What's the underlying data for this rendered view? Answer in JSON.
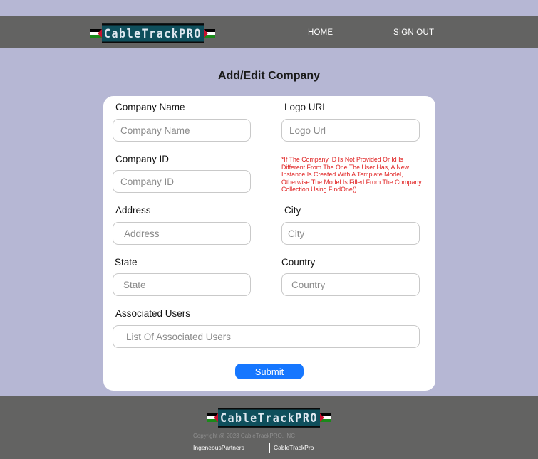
{
  "header": {
    "logo_text": "CableTrackPRO",
    "nav": {
      "home": "HOME",
      "sign_out": "SIGN OUT"
    }
  },
  "page": {
    "title": "Add/Edit Company"
  },
  "form": {
    "company_name": {
      "label": "Company Name",
      "placeholder": "Company Name",
      "value": ""
    },
    "logo_url": {
      "label": "Logo URL",
      "placeholder": "Logo Url",
      "value": ""
    },
    "company_id": {
      "label": "Company ID",
      "placeholder": "Company ID",
      "value": ""
    },
    "company_id_note": "*If The Company ID Is Not Provided Or Id Is Different From The One The User Has, A New Instance Is Created With A Template Model, Otherwise The Model Is Filled From The Company Collection Using FindOne().",
    "address": {
      "label": "Address",
      "placeholder": "Address",
      "value": ""
    },
    "city": {
      "label": "City",
      "placeholder": "City",
      "value": ""
    },
    "state": {
      "label": "State",
      "placeholder": "State",
      "value": ""
    },
    "country": {
      "label": "Country",
      "placeholder": "Country",
      "value": ""
    },
    "associated_users": {
      "label": "Associated Users",
      "placeholder": "List Of Associated Users",
      "value": ""
    },
    "submit_label": "Submit"
  },
  "footer": {
    "logo_text": "CableTrackPRO",
    "copyright": "Copyright @ 2023 CableTrackPRO, INC",
    "links": [
      "IngeneousPartners",
      "CableTrackPro"
    ]
  },
  "colors": {
    "background": "#b6b7d4",
    "navbar": "#636362",
    "accent": "#1677ff",
    "note_red": "#e02020"
  }
}
